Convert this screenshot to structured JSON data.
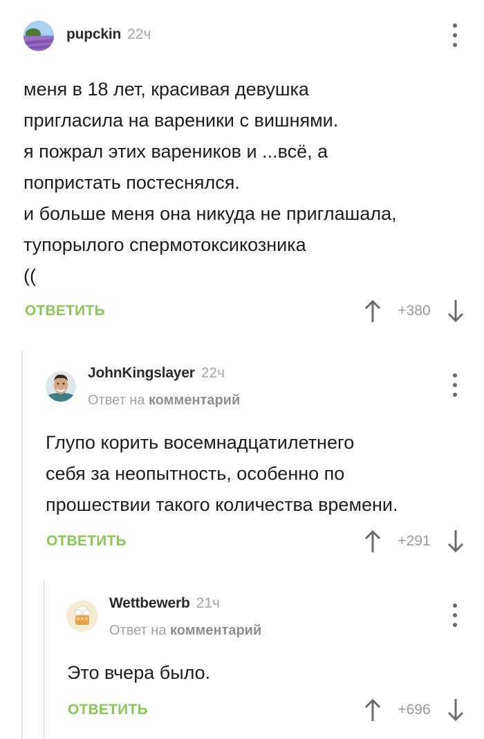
{
  "comments": [
    {
      "username": "pupckin",
      "time": "22ч",
      "text": "меня в 18 лет, красивая девушка\nпригласила на вареники с вишнями.\nя пожрал этих вареников и ...всё, а\nпопристать постеснялся.\nи больше меня она никуда не приглашала,\nтупорылого спермотоксикозника\n((",
      "reply_label": "ОТВЕТИТЬ",
      "score": "+380",
      "avatar_icon": "lavender-field-avatar"
    },
    {
      "username": "JohnKingslayer",
      "time": "22ч",
      "reply_prefix": "Ответ на",
      "reply_target": "комментарий",
      "text": "Глупо корить восемнадцатилетнего\nсебя за неопытность, особенно по\nпрошествии такого количества времени.",
      "reply_label": "ОТВЕТИТЬ",
      "score": "+291",
      "avatar_icon": "man-portrait-avatar"
    },
    {
      "username": "Wettbewerb",
      "time": "21ч",
      "reply_prefix": "Ответ на",
      "reply_target": "комментарий",
      "text": "Это вчера было.",
      "reply_label": "ОТВЕТИТЬ",
      "score": "+696",
      "avatar_icon": "chef-cartoon-avatar"
    }
  ],
  "colors": {
    "accent": "#8ac858",
    "thread_line": "#e6e6e6",
    "muted": "#a8a8a8"
  }
}
